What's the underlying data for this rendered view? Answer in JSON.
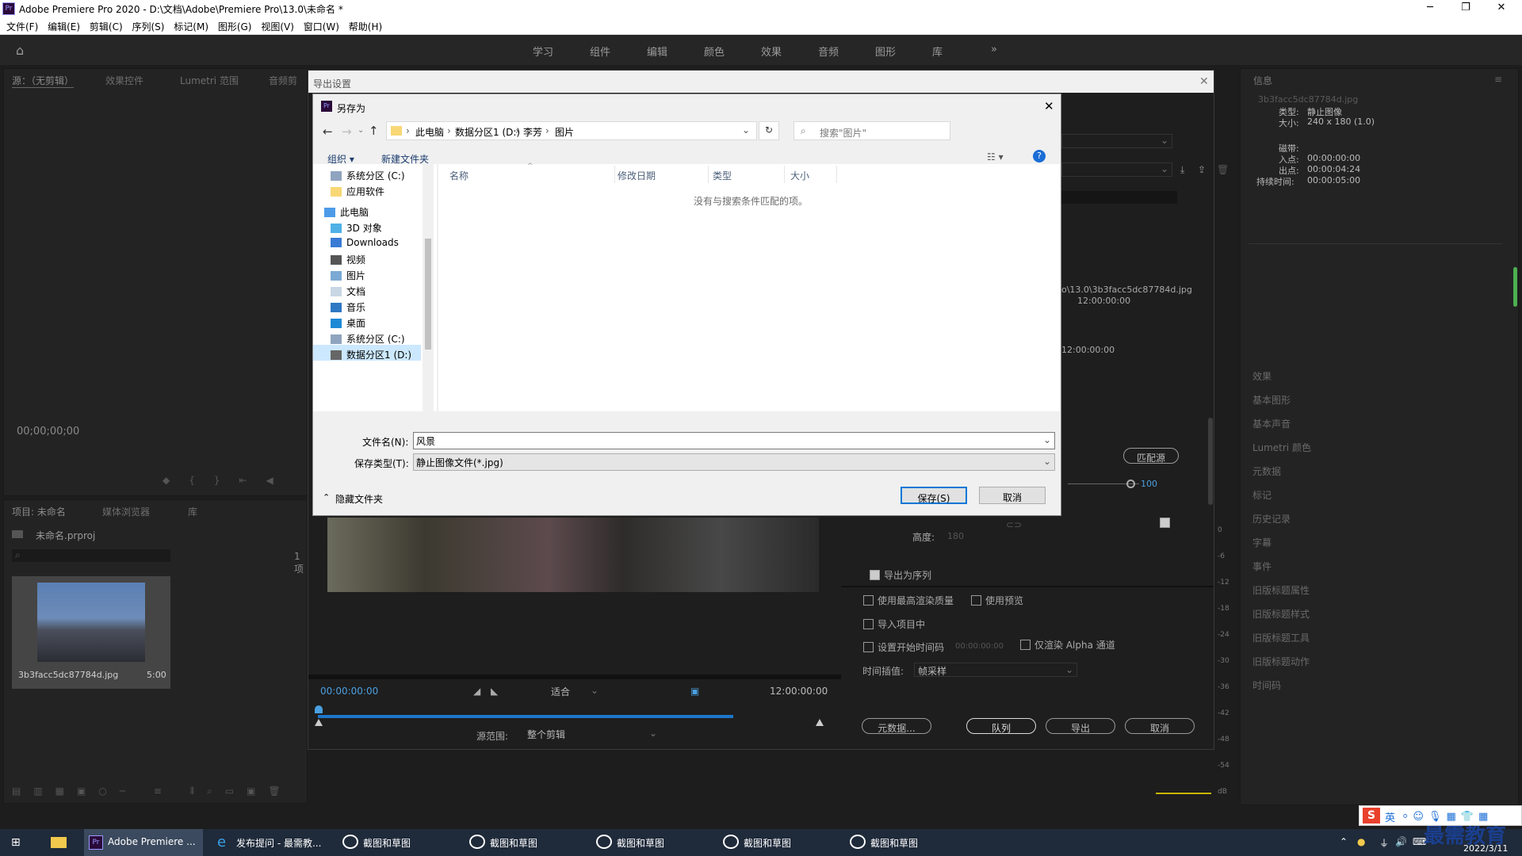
{
  "app": {
    "title": "Adobe Premiere Pro 2020 - D:\\文档\\Adobe\\Premiere Pro\\13.0\\未命名 *",
    "menu": [
      "文件(F)",
      "编辑(E)",
      "剪辑(C)",
      "序列(S)",
      "标记(M)",
      "图形(G)",
      "视图(V)",
      "窗口(W)",
      "帮助(H)"
    ],
    "workspaces": [
      "学习",
      "组件",
      "编辑",
      "颜色",
      "效果",
      "音频",
      "图形",
      "库"
    ],
    "workspace_more": "»"
  },
  "source_panel": {
    "tabs": [
      "源：（无剪辑）",
      "效果控件",
      "Lumetri 范围",
      "音频剪"
    ],
    "timecode": "00;00;00;00"
  },
  "project_panel": {
    "tabs": [
      "项目: 未命名",
      "媒体浏览器",
      "库"
    ],
    "project_file": "未命名.prproj",
    "item_count": "1 项",
    "clip_name": "3b3facc5dc87784d.jpg",
    "clip_duration": "5:00"
  },
  "info_panel": {
    "title": "信息",
    "filename": "3b3facc5dc87784d.jpg",
    "type_label": "类型:",
    "type_value": "静止图像",
    "size_label": "大小:",
    "size_value": "240 x 180 (1.0)",
    "tape_label": "磁带:",
    "in_label": "入点:",
    "in_value": "00:00:00:00",
    "out_label": "出点:",
    "out_value": "00:00:04:24",
    "dur_label": "持续时间:",
    "dur_value": "00:00:05:00"
  },
  "right_list": [
    "效果",
    "基本图形",
    "基本声音",
    "Lumetri 颜色",
    "元数据",
    "标记",
    "历史记录",
    "字幕",
    "事件",
    "旧版标题属性",
    "旧版标题样式",
    "旧版标题工具",
    "旧版标题动作",
    "时间码"
  ],
  "meter_ticks": [
    "0",
    "-6",
    "-12",
    "-18",
    "-24",
    "-30",
    "-36",
    "-42",
    "-48",
    "-54",
    "dB"
  ],
  "export_settings": {
    "title": "导出设置",
    "source_path": "o\\13.0\\3b3facc5dc87784d.jpg",
    "source_dur": "12:00:00:00",
    "out_dur": "12:00:00:00",
    "match_source": "匹配源",
    "value_100": "100",
    "height_label": "高度:",
    "height_value": "180",
    "export_as_sequence": "导出为序列",
    "max_quality": "使用最高渲染质量",
    "use_preview": "使用预览",
    "import_project": "导入项目中",
    "set_start_tc": "设置开始时间码",
    "start_tc_value": "00:00:00:00",
    "alpha_only": "仅渲染 Alpha 通道",
    "interp_label": "时间插值:",
    "interp_value": "帧采样",
    "metadata_btn": "元数据...",
    "queue_btn": "队列",
    "export_btn": "导出",
    "cancel_btn": "取消",
    "tl_start": "00:00:00:00",
    "tl_end": "12:00:00:00",
    "fit": "适合",
    "source_range_label": "源范围:",
    "source_range_value": "整个剪辑"
  },
  "saveas": {
    "title": "另存为",
    "breadcrumb": [
      "此电脑",
      "数据分区1 (D:)",
      "李芳",
      "图片"
    ],
    "search_placeholder": "搜索\"图片\"",
    "organize": "组织 ▾",
    "new_folder": "新建文件夹",
    "nav": [
      "系统分区 (C:)",
      "应用软件",
      "此电脑",
      "3D 对象",
      "Downloads",
      "视频",
      "图片",
      "文档",
      "音乐",
      "桌面",
      "系统分区 (C:)",
      "数据分区1 (D:)"
    ],
    "columns": [
      "名称",
      "修改日期",
      "类型",
      "大小"
    ],
    "empty_msg": "没有与搜索条件匹配的项。",
    "filename_label": "文件名(N):",
    "filename_value": "风景",
    "filetype_label": "保存类型(T):",
    "filetype_value": "静止图像文件(*.jpg)",
    "hide_folders": "隐藏文件夹",
    "save_btn": "保存(S)",
    "cancel_btn": "取消"
  },
  "taskbar": {
    "items": [
      "Adobe Premiere ...",
      "发布提问 - 最需教...",
      "截图和草图",
      "截图和草图",
      "截图和草图",
      "截图和草图",
      "截图和草图"
    ],
    "ime": "英",
    "watermark": "最需教育",
    "date": "2022/3/11"
  }
}
